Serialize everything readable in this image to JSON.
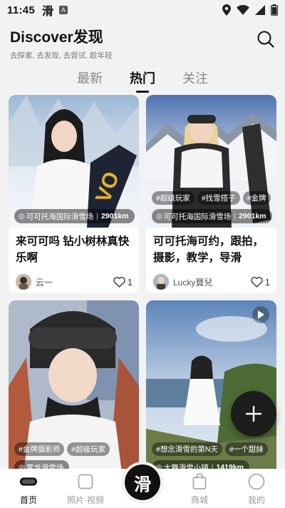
{
  "status": {
    "time": "11:45",
    "app_glyph": "滑",
    "badge": "A"
  },
  "header": {
    "title": "Discover发现",
    "subtitle": "去探索, 去发现, 去尝试, 趁年轻"
  },
  "tabs": [
    {
      "label": "最新",
      "active": false
    },
    {
      "label": "热门",
      "active": true
    },
    {
      "label": "关注",
      "active": false
    }
  ],
  "cards": [
    {
      "location": "可可托海国际滑雪场",
      "distance": "2901km",
      "title": "来可可吗 钻小树林真快乐啊",
      "user": "云一",
      "likes": "1",
      "tags": []
    },
    {
      "location": "可可托海国际滑雪场",
      "distance": "2901km",
      "title": "可可托海可约，跟拍，摄影，教学，导滑",
      "user": "Lucky寶兒",
      "likes": "1",
      "tags": [
        "#超级玩家",
        "#找雪搭子",
        "#金牌"
      ]
    },
    {
      "location": "富龙滑雪场",
      "distance": "",
      "title": "",
      "user": "",
      "likes": "",
      "tags": [
        "#金牌摄影师",
        "#超级玩家"
      ]
    },
    {
      "location": "太舞滑雪小镇",
      "distance": "1419km",
      "title": "",
      "user": "",
      "likes": "",
      "tags": [
        "#想念滑雪的第N天",
        "#一个甜妹"
      ]
    }
  ],
  "nav": [
    {
      "label": "首页",
      "icon": "goggles-icon",
      "active": true
    },
    {
      "label": "照片·视频",
      "icon": "square-icon",
      "active": false
    },
    {
      "label": "",
      "icon": "center-slide-icon",
      "active": false
    },
    {
      "label": "商城",
      "icon": "shopping-bag-icon",
      "active": false
    },
    {
      "label": "我的",
      "icon": "profile-circle-icon",
      "active": false
    }
  ],
  "center_button": "滑",
  "colors": {
    "accent": "#111111",
    "background": "#f2f2f2",
    "card": "#ffffff"
  }
}
